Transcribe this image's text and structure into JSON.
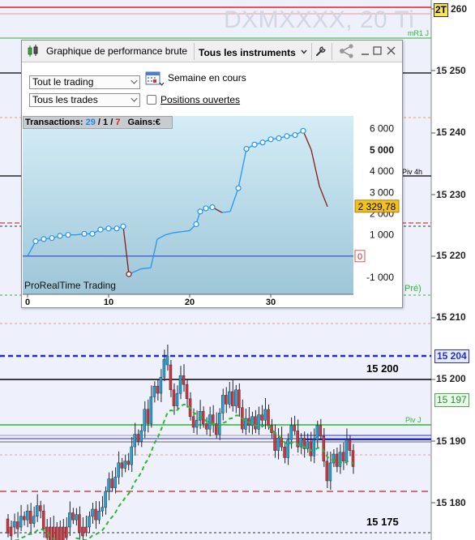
{
  "watermark": "DXMXXXX, 20 Ti",
  "price_axis": {
    "labels": [
      "260",
      "15 250",
      "15 240",
      "15 230",
      "15 220",
      "15 210",
      "15 200",
      "15 190",
      "15 180"
    ],
    "top_badge_prefix": "2T",
    "current_price": "15 204",
    "green_price": "15 197"
  },
  "levels": {
    "mr1": "mR1 J",
    "piv4h": "Piv 4h",
    "pre": "Pré)",
    "pivj": "Piv J",
    "label_15200": "15 200",
    "label_15175": "15 175"
  },
  "colors": {
    "bull": "#1aa7e0",
    "bear": "#d8323c",
    "equity_up": "#2196f3",
    "equity_down": "#8b1a1a",
    "green_line": "#2cb82c",
    "blue_dash": "#1f2bd0"
  },
  "window": {
    "title": "Graphique de performance brute",
    "instruments_label": "Tous les instruments",
    "icons": [
      "candlestick-icon",
      "wrench-icon",
      "share-icon",
      "minimize-icon",
      "maximize-icon",
      "close-icon"
    ],
    "filter1": "Tout le trading",
    "filter2": "Tous les trades",
    "period_label": "Semaine en cours",
    "open_positions_label": "Positions ouvertes",
    "open_positions_checked": false,
    "stats": {
      "prefix": "Transactions:",
      "total": "29",
      "sep1": "/",
      "wins": "1",
      "sep2": "/",
      "losses": "7",
      "gains_label": "Gains:",
      "currency": "€"
    },
    "brand": "ProRealTime Trading"
  },
  "chart_data": {
    "type": "line",
    "title": "Graphique de performance brute",
    "xlabel": "",
    "ylabel": "",
    "x_ticks": [
      "0",
      "10",
      "20",
      "30"
    ],
    "y_ticks": [
      "6 000",
      "5 000",
      "4 000",
      "3 000",
      "2 000",
      "1 000",
      "0",
      "-1 000"
    ],
    "y_ticks_bold": [
      "5 000"
    ],
    "ylim": [
      -1800,
      6600
    ],
    "xlim": [
      0,
      40
    ],
    "last_value_label": "2 329,78",
    "zero_label": "0",
    "series": [
      {
        "values": [
          [
            0,
            0
          ],
          [
            1,
            700
          ],
          [
            2,
            800
          ],
          [
            3,
            850
          ],
          [
            4,
            950
          ],
          [
            5,
            1000
          ],
          [
            6,
            1000
          ],
          [
            7,
            1050
          ],
          [
            8,
            1050
          ],
          [
            9,
            1250
          ],
          [
            10,
            1300
          ],
          [
            11,
            1300
          ],
          [
            11.8,
            1400
          ],
          [
            12.5,
            -850
          ],
          [
            14,
            -600
          ],
          [
            15.2,
            -550
          ],
          [
            16,
            800
          ],
          [
            17,
            1000
          ],
          [
            18,
            1100
          ],
          [
            19,
            1150
          ],
          [
            20,
            1200
          ],
          [
            20.8,
            1500
          ],
          [
            21.3,
            2100
          ],
          [
            22,
            2250
          ],
          [
            22.8,
            2300
          ],
          [
            24,
            2050
          ],
          [
            25,
            2100
          ],
          [
            26,
            3200
          ],
          [
            27,
            5050
          ],
          [
            28,
            5250
          ],
          [
            29,
            5350
          ],
          [
            30,
            5500
          ],
          [
            31,
            5550
          ],
          [
            32,
            5650
          ],
          [
            33,
            5700
          ],
          [
            34,
            5900
          ],
          [
            35,
            5000
          ],
          [
            36,
            3300
          ],
          [
            37,
            2330
          ]
        ],
        "markers": [
          [
            1,
            700
          ],
          [
            2,
            800
          ],
          [
            3,
            850
          ],
          [
            4,
            950
          ],
          [
            5,
            1000
          ],
          [
            7,
            1050
          ],
          [
            8,
            1050
          ],
          [
            9,
            1250
          ],
          [
            10,
            1300
          ],
          [
            11,
            1300
          ],
          [
            11.8,
            1400
          ],
          [
            12.5,
            -850
          ],
          [
            20.8,
            1500
          ],
          [
            21.3,
            2100
          ],
          [
            22,
            2250
          ],
          [
            22.8,
            2300
          ],
          [
            26,
            3200
          ],
          [
            27,
            5050
          ],
          [
            28,
            5250
          ],
          [
            29,
            5350
          ],
          [
            30,
            5500
          ],
          [
            31,
            5550
          ],
          [
            32,
            5650
          ],
          [
            33,
            5700
          ],
          [
            34,
            5900
          ]
        ]
      }
    ]
  }
}
